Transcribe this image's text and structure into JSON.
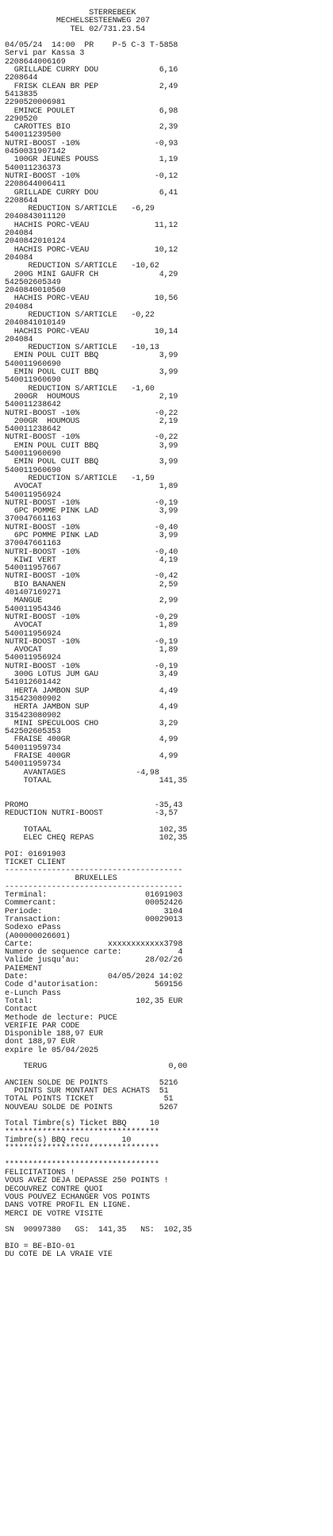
{
  "receipt": {
    "lines": [
      "                  STERREBEEK",
      "           MECHELSESTEENWEG 207",
      "              TEL 02/731.23.54",
      "",
      "04/05/24  14:00  PR    P-5 C-3 T-5858",
      "Servi par Kassa 3",
      "2208644006169",
      "  GRILLADE CURRY DOU             6,16",
      "2208644",
      "  FRISK CLEAN BR PEP             2,49",
      "5413835",
      "2290520006981",
      "  EMINCE POULET                  6,98",
      "2290520",
      "  CAROTTES BIO                   2,39",
      "540011239500",
      "NUTRI-BOOST -10%                -0,93",
      "0450031907142",
      "  100GR JEUNES POUSS             1,19",
      "540011236373",
      "NUTRI-BOOST -10%                -0,12",
      "2208644006411",
      "  GRILLADE CURRY DOU             6,41",
      "2208644",
      "     REDUCTION S/ARTICLE   -6,29",
      "2040843011120",
      "  HACHIS PORC-VEAU              11,12",
      "204084",
      "2040842010124",
      "  HACHIS PORC-VEAU              10,12",
      "204084",
      "     REDUCTION S/ARTICLE   -10,62",
      "  200G MINI GAUFR CH             4,29",
      "542502605349",
      "2040840010560",
      "  HACHIS PORC-VEAU              10,56",
      "204084",
      "     REDUCTION S/ARTICLE   -0,22",
      "2040841010149",
      "  HACHIS PORC-VEAU              10,14",
      "204084",
      "     REDUCTION S/ARTICLE   -10,13",
      "  EMIN POUL CUIT BBQ             3,99",
      "540011960690",
      "  EMIN POUL CUIT BBQ             3,99",
      "540011960690",
      "     REDUCTION S/ARTICLE   -1,60",
      "  200GR  HOUMOUS                 2,19",
      "540011238642",
      "NUTRI-BOOST -10%                -0,22",
      "  200GR  HOUMOUS                 2,19",
      "540011238642",
      "NUTRI-BOOST -10%                -0,22",
      "  EMIN POUL CUIT BBQ             3,99",
      "540011960690",
      "  EMIN POUL CUIT BBQ             3,99",
      "540011960690",
      "     REDUCTION S/ARTICLE   -1,59",
      "  AVOCAT                         1,89",
      "540011956924",
      "NUTRI-BOOST -10%                -0,19",
      "  6PC POMME PINK LAD             3,99",
      "370047661163",
      "NUTRI-BOOST -10%                -0,40",
      "  6PC POMME PINK LAD             3,99",
      "370047661163",
      "NUTRI-BOOST -10%                -0,40",
      "  KIWI VERT                      4,19",
      "540011957667",
      "NUTRI-BOOST -10%                -0,42",
      "  BIO BANANEN                    2,59",
      "401407169271",
      "  MANGUE                         2,99",
      "540011954346",
      "NUTRI-BOOST -10%                -0,29",
      "  AVOCAT                         1,89",
      "540011956924",
      "NUTRI-BOOST -10%                -0,19",
      "  AVOCAT                         1,89",
      "540011956924",
      "NUTRI-BOOST -10%                -0,19",
      "  300G LOTUS JUM GAU             3,49",
      "541012601442",
      "  HERTA JAMBON SUP               4,49",
      "315423080902",
      "  HERTA JAMBON SUP               4,49",
      "315423080902",
      "  MINI SPECULOOS CHO             3,29",
      "542502605353",
      "  FRAISE 400GR                   4,99",
      "540011959734",
      "  FRAISE 400GR                   4,99",
      "540011959734",
      "    AVANTAGES               -4,98",
      "    TOTAAL                       141,35",
      "",
      "",
      "PROMO                           -35,43",
      "REDUCTION NUTRI-BOOST           -3,57",
      "",
      "    TOTAAL                       102,35",
      "    ELEC CHEQ REPAS              102,35",
      "",
      "POI: 01691903",
      "TICKET CLIENT",
      "--------------------------------------",
      "               BRUXELLES",
      "--------------------------------------",
      "Terminal:                     01691903",
      "Commercant:                   00052426",
      "Periode:                          3104",
      "Transaction:                  00029013",
      "Sodexo ePass",
      "(A00000026601)",
      "Carte:                xxxxxxxxxxxx3798",
      "Numero de sequence carte:            4",
      "Valide jusqu'au:              28/02/26",
      "PAIEMENT",
      "Date:                 04/05/2024 14:02",
      "Code d'autorisation:            569156",
      "e-Lunch Pass",
      "Total:                      102,35 EUR",
      "Contact",
      "Methode de lecture: PUCE",
      "VERIFIE PAR CODE",
      "Disponible 188,97 EUR",
      "dont 188,97 EUR",
      "expire le 05/04/2025",
      "",
      "    TERUG                          0,00",
      "",
      "ANCIEN SOLDE DE POINTS           5216",
      "  POINTS SUR MONTANT DES ACHATS  51",
      "TOTAL POINTS TICKET               51",
      "NOUVEAU SOLDE DE POINTS          5267",
      "",
      "Total Timbre(s) Ticket BBQ     10",
      "*********************************",
      "Timbre(s) BBQ recu       10",
      "*********************************",
      "",
      "*********************************",
      "FELICITATIONS !",
      "VOUS AVEZ DEJA DEPASSE 250 POINTS !",
      "DECOUVREZ CONTRE QUOI",
      "VOUS POUVEZ ECHANGER VOS POINTS",
      "DANS VOTRE PROFIL EN LIGNE.",
      "MERCI DE VOTRE VISITE",
      "",
      "SN  90997380   GS:  141,35   NS:  102,35",
      "",
      "BIO = BE-BIO-01",
      "DU COTE DE LA VRAIE VIE"
    ]
  }
}
